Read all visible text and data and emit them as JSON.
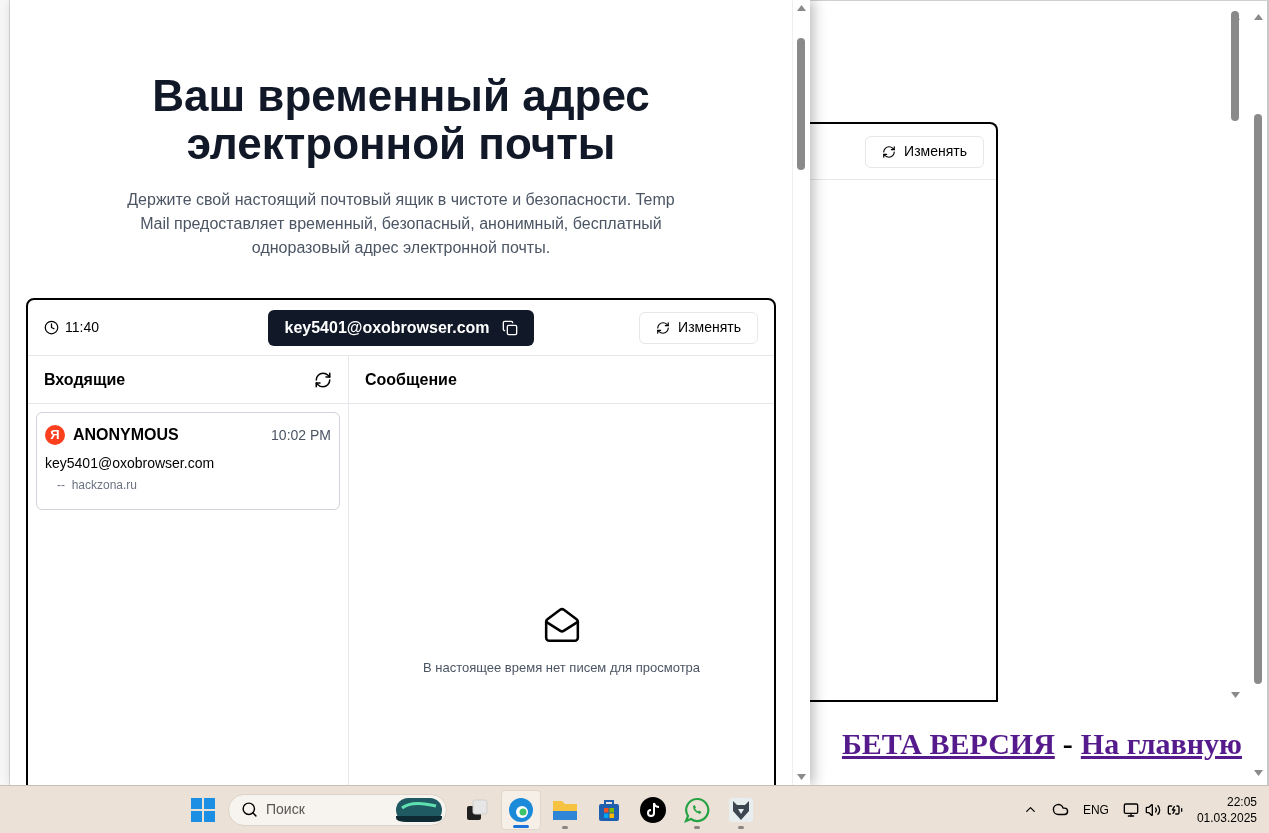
{
  "background_window": {
    "change_button": "Изменять",
    "links": [
      {
        "text": "БЕТА ВЕРСИЯ"
      },
      {
        "text": "На главную"
      }
    ],
    "separator": "-"
  },
  "popup": {
    "title": "Ваш временный адрес электронной почты",
    "description": "Держите свой настоящий почтовый ящик в чистоте и безопасности. Temp Mail предоставляет временный, безопасный, анонимный, бесплатный одноразовый адрес электронной почты.",
    "mail": {
      "time": "11:40",
      "address": "key5401@oxobrowser.com",
      "change_button": "Изменять",
      "inbox": {
        "title": "Входящие",
        "messages": [
          {
            "avatar_letter": "Я",
            "sender": "ANONYMOUS",
            "time": "10:02 PM",
            "to": "key5401@oxobrowser.com",
            "preview": "--  hackzona.ru",
            "selected": false
          }
        ]
      },
      "message": {
        "title": "Сообщение",
        "empty_text": "В настоящее время нет писем для просмотра"
      }
    }
  },
  "taskbar": {
    "search_placeholder": "Поиск",
    "apps": [
      {
        "kind": "task-view",
        "running": false,
        "active": false
      },
      {
        "kind": "edge",
        "running": true,
        "active": true
      },
      {
        "kind": "explorer",
        "running": true,
        "active": false
      },
      {
        "kind": "store",
        "running": false,
        "active": false
      },
      {
        "kind": "tiktok",
        "running": false,
        "active": false
      },
      {
        "kind": "whatsapp",
        "running": true,
        "active": false
      },
      {
        "kind": "wolf",
        "running": true,
        "active": false
      }
    ],
    "tray": {
      "language": "ENG",
      "time": "22:05",
      "date": "01.03.2025"
    }
  }
}
